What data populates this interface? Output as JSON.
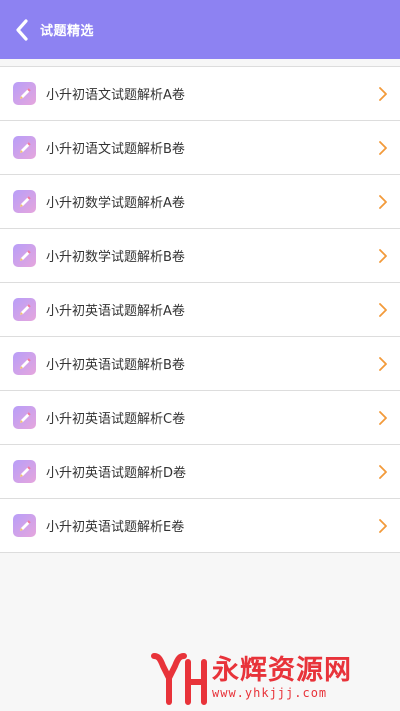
{
  "header": {
    "title": "试题精选",
    "back_icon": "chevron-left-icon",
    "background": "#8d82f2"
  },
  "list": {
    "items": [
      {
        "label": "小升初语文试题解析A卷",
        "icon": "pencil-icon"
      },
      {
        "label": "小升初语文试题解析B卷",
        "icon": "pencil-icon"
      },
      {
        "label": "小升初数学试题解析A卷",
        "icon": "pencil-icon"
      },
      {
        "label": "小升初数学试题解析B卷",
        "icon": "pencil-icon"
      },
      {
        "label": "小升初英语试题解析A卷",
        "icon": "pencil-icon"
      },
      {
        "label": "小升初英语试题解析B卷",
        "icon": "pencil-icon"
      },
      {
        "label": "小升初英语试题解析C卷",
        "icon": "pencil-icon"
      },
      {
        "label": "小升初英语试题解析D卷",
        "icon": "pencil-icon"
      },
      {
        "label": "小升初英语试题解析E卷",
        "icon": "pencil-icon"
      }
    ],
    "chevron_color": "#f29a3a"
  },
  "watermark": {
    "name": "永辉资源网",
    "url": "www.yhkjjj.com",
    "color": "#e8333a"
  }
}
